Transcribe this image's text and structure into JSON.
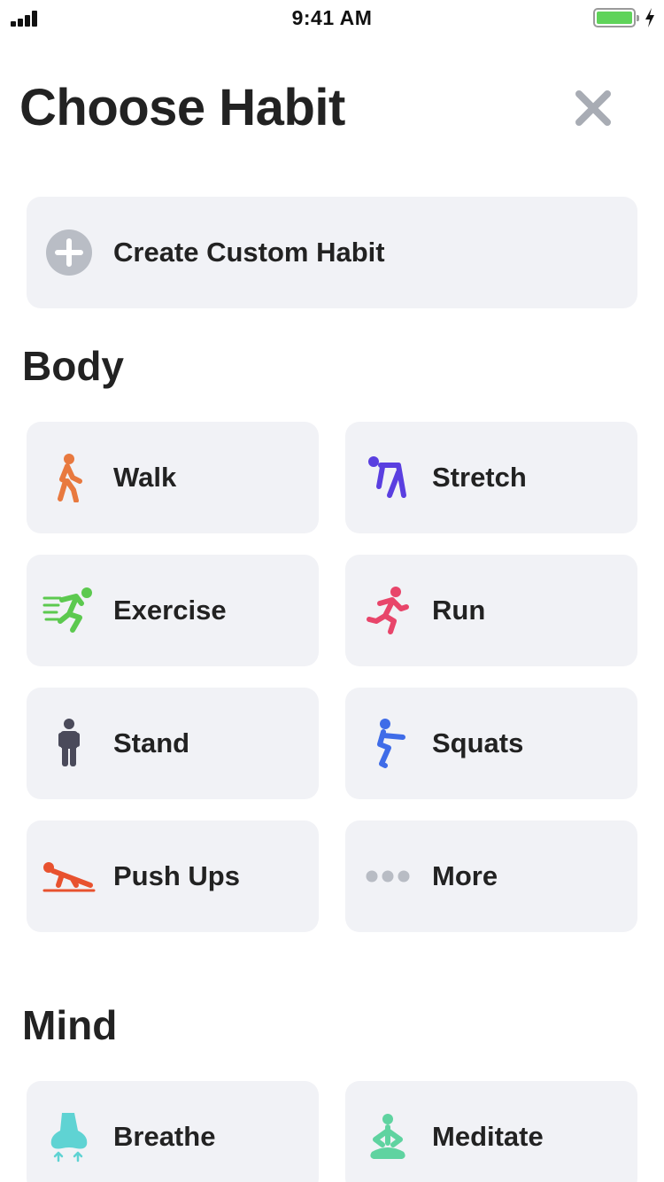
{
  "status_bar": {
    "time": "9:41 AM"
  },
  "header": {
    "title": "Choose Habit"
  },
  "custom_habit": {
    "label": "Create Custom Habit",
    "icon": "plus-circle-icon"
  },
  "sections": {
    "body": {
      "title": "Body",
      "items": [
        {
          "label": "Walk",
          "icon": "walk-icon",
          "color": "#e8793f"
        },
        {
          "label": "Stretch",
          "icon": "stretch-icon",
          "color": "#5a3fe0"
        },
        {
          "label": "Exercise",
          "icon": "exercise-icon",
          "color": "#5cc94f"
        },
        {
          "label": "Run",
          "icon": "run-icon",
          "color": "#e8456a"
        },
        {
          "label": "Stand",
          "icon": "stand-icon",
          "color": "#4a4a5a"
        },
        {
          "label": "Squats",
          "icon": "squats-icon",
          "color": "#3f6ce8"
        },
        {
          "label": "Push Ups",
          "icon": "push-ups-icon",
          "color": "#e8522f"
        },
        {
          "label": "More",
          "icon": "more-dots-icon",
          "color": "#b8bcc4"
        }
      ]
    },
    "mind": {
      "title": "Mind",
      "items": [
        {
          "label": "Breathe",
          "icon": "breathe-icon",
          "color": "#5fd3d3"
        },
        {
          "label": "Meditate",
          "icon": "meditate-icon",
          "color": "#5fd3a0"
        }
      ]
    }
  },
  "colors": {
    "card_background": "#f1f2f6",
    "text": "#222222",
    "close_icon": "#a8acb4",
    "battery": "#5fd35a"
  }
}
